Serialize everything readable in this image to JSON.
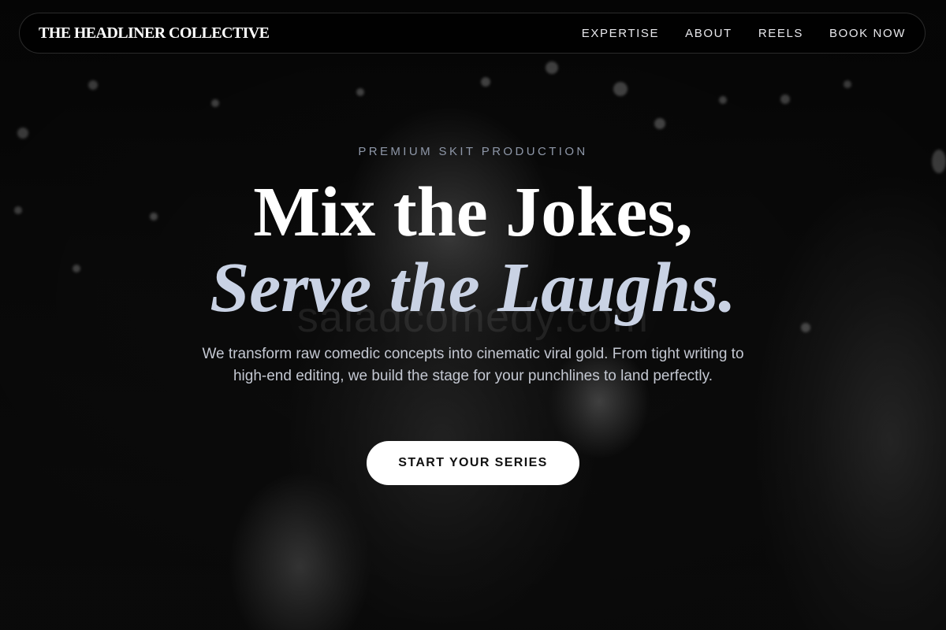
{
  "nav": {
    "brand": "THE HEADLINER COLLECTIVE",
    "links": [
      "EXPERTISE",
      "ABOUT",
      "REELS",
      "BOOK NOW"
    ]
  },
  "hero": {
    "eyebrow": "PREMIUM SKIT PRODUCTION",
    "headline_line1": "Mix the Jokes,",
    "headline_line2": "Serve the Laughs.",
    "subtext": "We transform raw comedic concepts into cinematic viral gold. From tight writing to high-end editing, we build the stage for your punchlines to land perfectly.",
    "cta_label": "START YOUR SERIES",
    "watermark": "saladcomedy.com"
  },
  "colors": {
    "background": "#050505",
    "headline_accent": "#c9d2e4",
    "eyebrow": "#8e97a8",
    "cta_bg": "#ffffff",
    "cta_text": "#111111"
  }
}
